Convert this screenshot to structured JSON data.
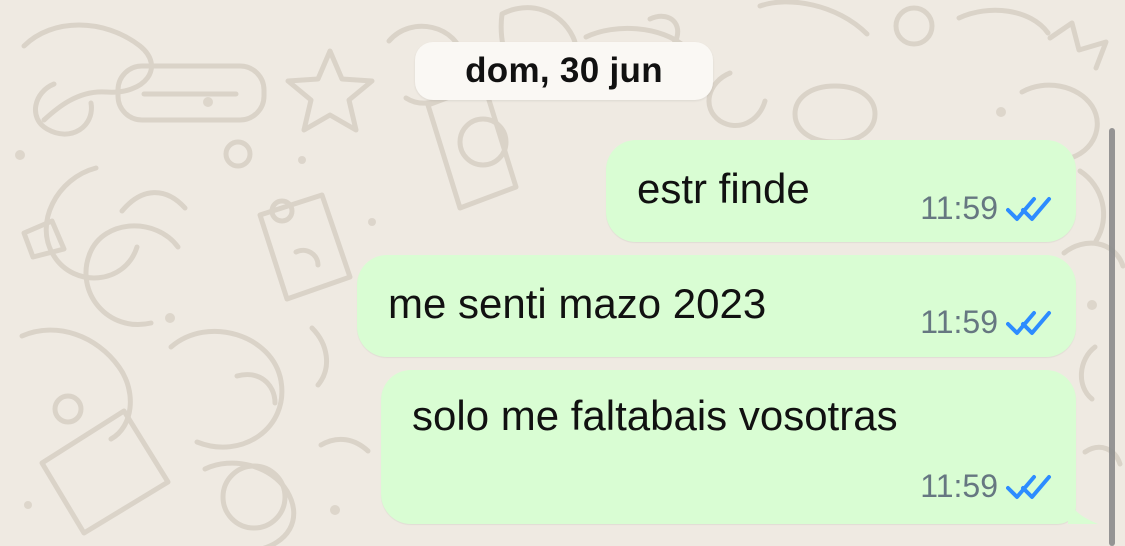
{
  "chat": {
    "date_label": "dom, 30 jun",
    "messages": [
      {
        "text": "estr finde",
        "time": "11:59",
        "status_icon": "double-check-icon"
      },
      {
        "text": "me senti mazo 2023",
        "time": "11:59",
        "status_icon": "double-check-icon"
      },
      {
        "text": "solo me faltabais vosotras",
        "time": "11:59",
        "status_icon": "double-check-icon"
      }
    ]
  },
  "colors": {
    "background": "#efeae2",
    "outgoing_bubble": "#d9fdd3",
    "date_pill": "#faf8f4",
    "timestamp": "#667781",
    "read_check": "#2d8cff",
    "scrollbar": "#8f8f8f"
  }
}
